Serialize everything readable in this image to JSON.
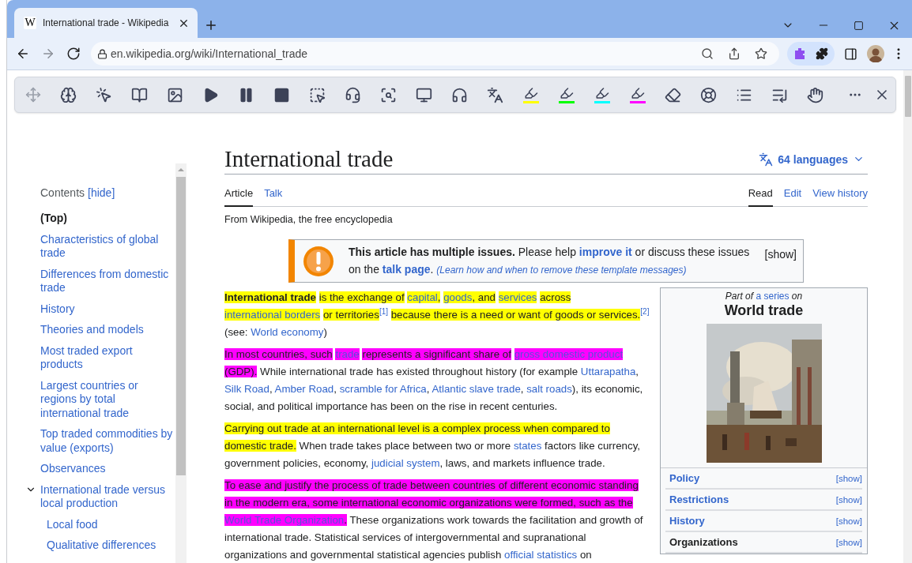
{
  "browser": {
    "tab": {
      "favicon": "W",
      "title": "International trade - Wikipedia",
      "selected": true
    },
    "url": "en.wikipedia.org/wiki/International_trade"
  },
  "reader_toolbar": {
    "highlighters": [
      {
        "color": "#ffff00"
      },
      {
        "color": "#00ff00"
      },
      {
        "color": "#00ffff"
      },
      {
        "color": "#ff00ff"
      }
    ]
  },
  "toc": {
    "title": "Contents",
    "toggle": "[hide]",
    "items": [
      {
        "label": "(Top)",
        "selected": true
      },
      {
        "label": "Characteristics of global trade",
        "selected": false
      },
      {
        "label": "Differences from domestic trade",
        "selected": false
      },
      {
        "label": "History",
        "selected": false
      },
      {
        "label": "Theories and models",
        "selected": false
      },
      {
        "label": "Most traded export products",
        "selected": false
      },
      {
        "label": "Largest countries or regions by total international trade",
        "selected": false
      },
      {
        "label": "Top traded commodities by value (exports)",
        "selected": false
      },
      {
        "label": "Observances",
        "selected": false
      },
      {
        "label": "International trade versus local production",
        "selected": false,
        "expanded": true,
        "children": [
          {
            "label": "Local food",
            "selected": false
          },
          {
            "label": "Qualitative differences",
            "selected": false
          }
        ]
      }
    ]
  },
  "article": {
    "title": "International trade",
    "languages": "64 languages",
    "tabs_left": [
      {
        "label": "Article",
        "selected": true
      },
      {
        "label": "Talk",
        "selected": false
      }
    ],
    "tabs_right": [
      {
        "label": "Read",
        "selected": true
      },
      {
        "label": "Edit",
        "selected": false
      },
      {
        "label": "View history",
        "selected": false
      }
    ],
    "tagline": "From Wikipedia, the free encyclopedia",
    "notice": {
      "segments": [
        {
          "text": "This article has multiple issues.",
          "kind": "bold"
        },
        {
          "text": " Please help ",
          "kind": "plain"
        },
        {
          "text": "improve it",
          "kind": "boldlink"
        },
        {
          "text": " or discuss these issues on the ",
          "kind": "plain"
        },
        {
          "text": "talk page",
          "kind": "boldlink"
        },
        {
          "text": ". ",
          "kind": "plain"
        },
        {
          "text": "(Learn how and when to remove these template messages)",
          "kind": "smalllink"
        }
      ],
      "toggle": "[show]"
    },
    "paragraphs": [
      {
        "segments": [
          {
            "text": "International trade",
            "kind": "bold",
            "color": "#ffff00"
          },
          {
            "text": " is the exchange of ",
            "kind": "plain",
            "color": "#ffff00"
          },
          {
            "text": "capital",
            "kind": "link",
            "color": "#ffff00"
          },
          {
            "text": ", ",
            "kind": "plain",
            "color": "#ffff00"
          },
          {
            "text": "goods",
            "kind": "link",
            "color": "#ffff00"
          },
          {
            "text": ", and ",
            "kind": "plain",
            "color": "#ffff00"
          },
          {
            "text": "services",
            "kind": "link",
            "color": "#ffff00"
          },
          {
            "text": " across ",
            "kind": "plain",
            "color": "#ffff00"
          },
          {
            "text": "international borders",
            "kind": "link",
            "color": "#ffff00"
          },
          {
            "text": " or territories",
            "kind": "plain",
            "color": "#ffff00"
          },
          {
            "text": "[1]",
            "kind": "ref"
          },
          {
            "text": " because there is a need or want of goods or services.",
            "kind": "plain",
            "color": "#ffff00"
          },
          {
            "text": "[2]",
            "kind": "ref"
          },
          {
            "text": " (see: ",
            "kind": "plain"
          },
          {
            "text": "World economy",
            "kind": "link"
          },
          {
            "text": ")",
            "kind": "plain"
          }
        ]
      },
      {
        "segments": [
          {
            "text": "In most countries, such ",
            "kind": "plain",
            "color": "#ff00ff"
          },
          {
            "text": "trade",
            "kind": "link",
            "color": "#ff00ff"
          },
          {
            "text": " represents a significant share of ",
            "kind": "plain",
            "color": "#ff00ff"
          },
          {
            "text": "gross domestic product",
            "kind": "link",
            "color": "#ff00ff"
          },
          {
            "text": " (GDP). ",
            "kind": "plain",
            "color": "#ff00ff"
          },
          {
            "text": "While international trade has existed throughout history (for example ",
            "kind": "plain"
          },
          {
            "text": "Uttarapatha",
            "kind": "link"
          },
          {
            "text": ", ",
            "kind": "plain"
          },
          {
            "text": "Silk Road",
            "kind": "link"
          },
          {
            "text": ", ",
            "kind": "plain"
          },
          {
            "text": "Amber Road",
            "kind": "link"
          },
          {
            "text": ", ",
            "kind": "plain"
          },
          {
            "text": "scramble for Africa",
            "kind": "link"
          },
          {
            "text": ", ",
            "kind": "plain"
          },
          {
            "text": "Atlantic slave trade",
            "kind": "link"
          },
          {
            "text": ", ",
            "kind": "plain"
          },
          {
            "text": "salt roads",
            "kind": "link"
          },
          {
            "text": "), its economic, social, and political importance has been on the rise in recent centuries.",
            "kind": "plain"
          }
        ]
      },
      {
        "segments": [
          {
            "text": "Carrying out trade at an international level is a complex process when compared to",
            "kind": "plain",
            "color": "#ffff00"
          },
          {
            "text": " domestic trade. ",
            "kind": "plain",
            "color": "#ffff00"
          },
          {
            "text": "When trade takes place between two or more ",
            "kind": "plain"
          },
          {
            "text": "states",
            "kind": "link"
          },
          {
            "text": " factors like currency, government policies, economy, ",
            "kind": "plain"
          },
          {
            "text": "judicial system",
            "kind": "link"
          },
          {
            "text": ", laws, and markets influence trade.",
            "kind": "plain"
          }
        ]
      },
      {
        "segments": [
          {
            "text": "To ease and justify the process of trade between countries of different economic standing",
            "kind": "plain",
            "color": "#ff00ff"
          },
          {
            "text": " in the modern era, some international economic organizations were formed, such as the ",
            "kind": "plain",
            "color": "#ff00ff"
          },
          {
            "text": "World Trade Organization",
            "kind": "link",
            "color": "#ff00ff"
          },
          {
            "text": ". ",
            "kind": "plain",
            "color": "#ff00ff"
          },
          {
            "text": "These organizations work towards the facilitation and growth of international trade. Statistical services of intergovernmental and supranational organizations and governmental statistical agencies publish ",
            "kind": "plain"
          },
          {
            "text": "official statistics",
            "kind": "link"
          },
          {
            "text": " on",
            "kind": "plain"
          }
        ]
      }
    ],
    "infobox": {
      "pretitle": [
        {
          "text": "Part of ",
          "kind": "plain"
        },
        {
          "text": "a series",
          "kind": "link"
        },
        {
          "text": " on",
          "kind": "plain"
        }
      ],
      "title": "World trade",
      "sections": [
        {
          "label": "Policy",
          "kind": "link",
          "toggle": "[show]"
        },
        {
          "label": "Restrictions",
          "kind": "link",
          "toggle": "[show]"
        },
        {
          "label": "History",
          "kind": "link",
          "toggle": "[show]"
        },
        {
          "label": "Organizations",
          "kind": "heading",
          "toggle": "[show]"
        }
      ]
    }
  }
}
